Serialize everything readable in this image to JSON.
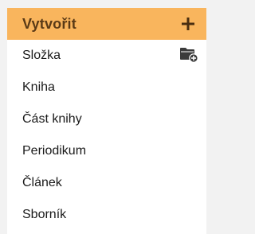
{
  "create_menu": {
    "title": "Vytvořit",
    "header_icon": "plus-icon",
    "header_color": "#f9b55d",
    "items": [
      {
        "label": "Složka",
        "icon": "folder-add-icon"
      },
      {
        "label": "Kniha"
      },
      {
        "label": "Část knihy"
      },
      {
        "label": "Periodikum"
      },
      {
        "label": "Článek"
      },
      {
        "label": "Sborník"
      }
    ]
  }
}
